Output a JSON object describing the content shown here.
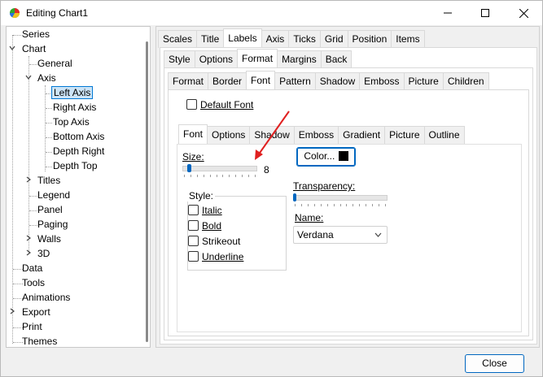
{
  "window": {
    "title": "Editing Chart1",
    "icons": [
      "chart-app-icon",
      "minimize-icon",
      "maximize-icon",
      "close-icon"
    ]
  },
  "tree": {
    "items": [
      {
        "label": "Series"
      },
      {
        "label": "Chart"
      },
      {
        "label": "General"
      },
      {
        "label": "Axis"
      },
      {
        "label": "Left Axis"
      },
      {
        "label": "Right Axis"
      },
      {
        "label": "Top Axis"
      },
      {
        "label": "Bottom Axis"
      },
      {
        "label": "Depth Right"
      },
      {
        "label": "Depth Top"
      },
      {
        "label": "Titles"
      },
      {
        "label": "Legend"
      },
      {
        "label": "Panel"
      },
      {
        "label": "Paging"
      },
      {
        "label": "Walls"
      },
      {
        "label": "3D"
      },
      {
        "label": "Data"
      },
      {
        "label": "Tools"
      },
      {
        "label": "Animations"
      },
      {
        "label": "Export"
      },
      {
        "label": "Print"
      },
      {
        "label": "Themes"
      }
    ],
    "selected": "Left Axis"
  },
  "tabs_level1": [
    "Scales",
    "Title",
    "Labels",
    "Axis",
    "Ticks",
    "Grid",
    "Position",
    "Items"
  ],
  "tabs_level1_active": "Labels",
  "tabs_level2": [
    "Style",
    "Options",
    "Format",
    "Margins",
    "Back"
  ],
  "tabs_level2_active": "Format",
  "tabs_level3": [
    "Format",
    "Border",
    "Font",
    "Pattern",
    "Shadow",
    "Emboss",
    "Picture",
    "Children"
  ],
  "tabs_level3_active": "Font",
  "default_font": {
    "label": "Default Font",
    "checked": false
  },
  "tabs_level4": [
    "Font",
    "Options",
    "Shadow",
    "Emboss",
    "Gradient",
    "Picture",
    "Outline"
  ],
  "tabs_level4_active": "Font",
  "font": {
    "size_label": "Size:",
    "size_value": "8",
    "size_level": 0.05,
    "style_label": "Style:",
    "styles": [
      {
        "label": "Italic",
        "checked": false
      },
      {
        "label": "Bold",
        "checked": false
      },
      {
        "label": "Strikeout",
        "checked": false
      },
      {
        "label": "Underline",
        "checked": false
      }
    ],
    "color_button": "Color...",
    "color_value": "#000000",
    "transparency_label": "Transparency:",
    "transparency_level": 0.0,
    "name_label": "Name:",
    "name_value": "Verdana"
  },
  "annotation_color": "#e02020",
  "footer": {
    "close_label": "Close"
  }
}
